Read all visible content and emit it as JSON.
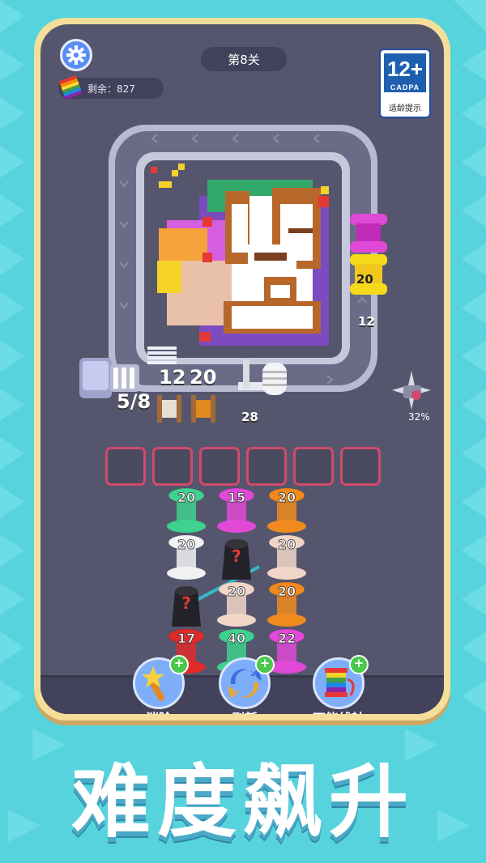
{
  "header": {
    "level_label": "第8关",
    "remaining_label": "剩余：827"
  },
  "age_rating": {
    "rating": "12+",
    "org": "CADPA",
    "caption": "适龄提示"
  },
  "board": {
    "right_spool_count": "20",
    "right_track_count": "12",
    "counter_fraction": "5/8",
    "counter_a": "12",
    "counter_b": "20",
    "bottom_count": "28",
    "progress_percent": "32%"
  },
  "slots": [
    {},
    {},
    {},
    {},
    {},
    {}
  ],
  "spool_columns": [
    [
      "20",
      "20",
      "?",
      "17"
    ],
    [
      "15",
      "?",
      "20",
      "40"
    ],
    [
      "20",
      "20",
      "20",
      "22"
    ]
  ],
  "powerups": [
    {
      "label": "消除",
      "icon": "magic-wand-icon"
    },
    {
      "label": "刷新",
      "icon": "refresh-icon"
    },
    {
      "label": "万能线轴",
      "icon": "rainbow-spool-icon"
    }
  ],
  "banner": {
    "headline": "难度飙升"
  },
  "colors": {
    "background": "#57d3dd",
    "frame": "#f5de9a",
    "screen": "#55566e",
    "slot_border": "#d24a6a",
    "powerup": "#7eaef9"
  }
}
